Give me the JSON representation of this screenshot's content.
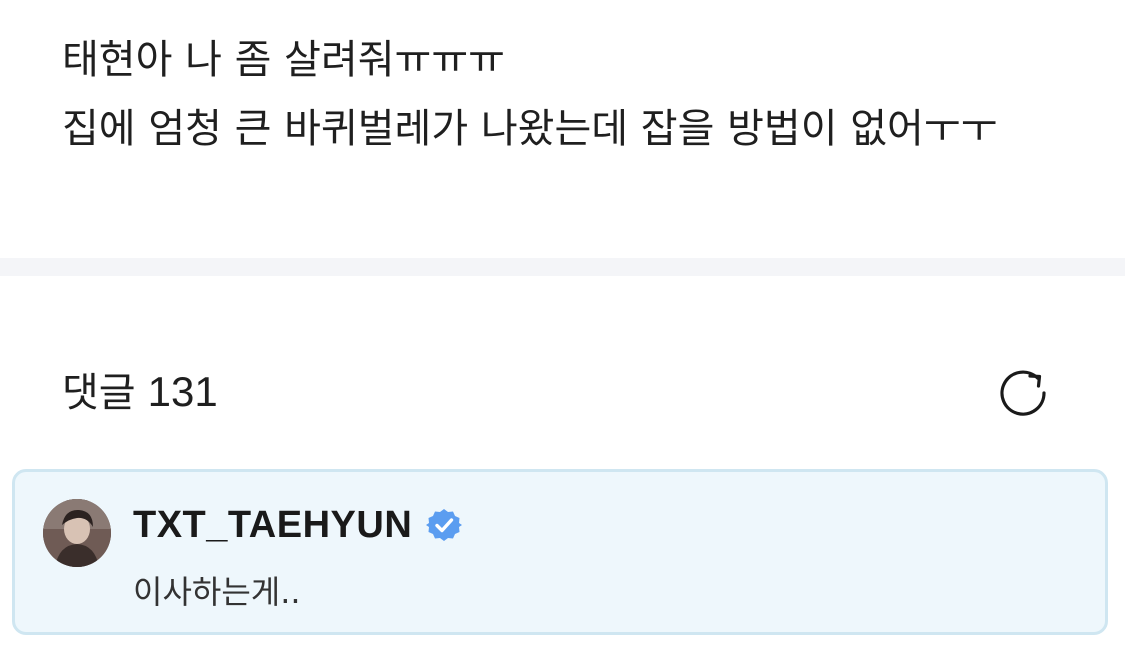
{
  "post": {
    "body": "태현아 나 좀 살려줘ㅠㅠㅠ\n집에 엄청 큰 바퀴벌레가 나왔는데 잡을 방법이 없어ㅜㅜ"
  },
  "comments": {
    "label": "댓글",
    "count": "131",
    "refresh_icon": "refresh-icon"
  },
  "comment": {
    "author": "TXT_TAEHYUN",
    "verified_icon": "verified-badge-icon",
    "text": "이사하는게..",
    "accent_color": "#5b9df0",
    "card_bg": "#eef7fc"
  }
}
